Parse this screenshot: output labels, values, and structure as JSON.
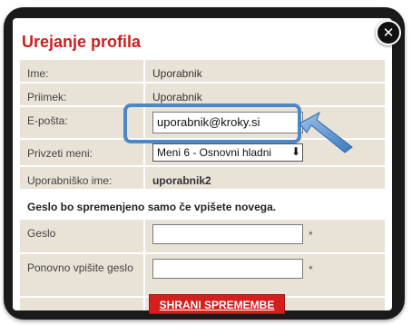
{
  "dialog": {
    "title": "Urejanje profila",
    "close_icon": "close-icon"
  },
  "fields": {
    "name": {
      "label": "Ime:",
      "value": "Uporabnik"
    },
    "surname": {
      "label": "Priimek:",
      "value": "Uporabnik"
    },
    "email": {
      "label": "E-pošta:",
      "value": "uporabnik@kroky.si"
    },
    "default_menu": {
      "label": "Privzeti meni:",
      "selected": "Meni 6 - Osnovni hladni"
    },
    "username": {
      "label": "Uporabniško ime:",
      "value": "uporabnik2"
    }
  },
  "password_notice": "Geslo bo spremenjeno samo če vpišete novega.",
  "password": {
    "label": "Geslo",
    "required_mark": "*"
  },
  "password_repeat": {
    "label": "Ponovno vpišite geslo",
    "required_mark": "*"
  },
  "email_required_mark": "*",
  "save_label": "SHRANI SPREMEMBE",
  "colors": {
    "title_red": "#cc1f1f",
    "button_red": "#d51f1f",
    "row_beige": "#e9e2d6",
    "highlight_blue": "#4a88c8"
  }
}
